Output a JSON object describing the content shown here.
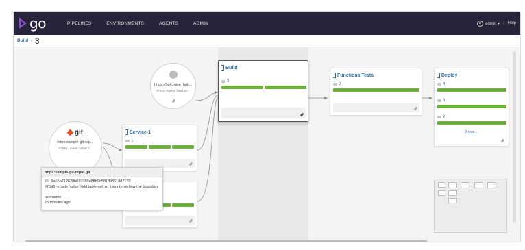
{
  "app": {
    "logo_text": "go",
    "brand_color": "#8e4bd4",
    "header_bg": "#26233b"
  },
  "nav": [
    {
      "label": "PIPELINES"
    },
    {
      "label": "ENVIRONMENTS"
    },
    {
      "label": "AGENTS"
    },
    {
      "label": "ADMIN"
    }
  ],
  "user": {
    "name": "admin ▾",
    "help": "Help",
    "icon": "user-avatar-icon"
  },
  "breadcrumb": {
    "pipeline": "Build",
    "separator": "»",
    "counter": "3"
  },
  "materials": {
    "hg": {
      "logo": "mercurial-icon",
      "url": "https://hg/cruise_buil...",
      "revision": "#7315 -styling fixed an...",
      "more": "..."
    },
    "git": {
      "logo_text": "git",
      "url": "https:sample-git-rep...",
      "revision": "#7596 - made 'value' fi...",
      "more": "..."
    }
  },
  "pipelines": {
    "service1": {
      "name": "Service-1",
      "counter": "1",
      "stages": 3
    },
    "service2": {
      "stages": 3
    },
    "build": {
      "name": "Build",
      "counter": "3",
      "stages": 2
    },
    "functional": {
      "name": "FunctionalTests",
      "counter": "2",
      "stages": 1
    },
    "deploy": {
      "name": "Deploy",
      "instances": [
        {
          "counter": "4"
        },
        {
          "counter": "3"
        },
        {
          "counter": "2"
        }
      ],
      "less_label": "2 less..."
    }
  },
  "tooltip": {
    "title": "https:sample-git-repot.git",
    "hash": "9a65a712628b010389a8ffb9d581ff93618d7170",
    "message": "#7596 - made 'value' field table-cell so it wont overflow the boundary",
    "author": "username",
    "time": "25 minutes ago"
  },
  "colors": {
    "passed": "#6cb23a",
    "link": "#2e6da4"
  }
}
